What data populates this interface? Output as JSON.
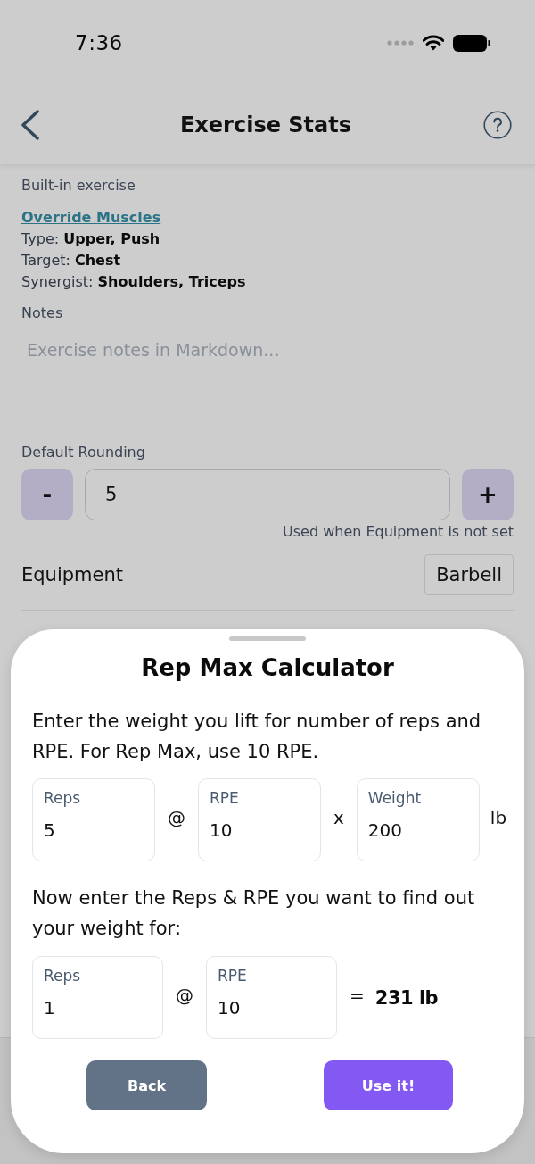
{
  "status_bar": {
    "time": "7:36"
  },
  "header": {
    "title": "Exercise Stats"
  },
  "exercise": {
    "subtitle": "Built-in exercise",
    "override_link": "Override Muscles",
    "muscles": [
      "Type: **Upper, Push**",
      "Target: **Chest**",
      "Synergist: **Shoulders, Triceps**"
    ]
  },
  "notes": {
    "label": "Notes",
    "placeholder": "Exercise notes in Markdown..."
  },
  "rounding": {
    "label": "Default Rounding",
    "decrement": "-",
    "value": "5",
    "increment": "+",
    "hint": "Used when Equipment is not set"
  },
  "equipment": {
    "label": "Equipment",
    "value": "Barbell"
  },
  "calculator": {
    "title": "Rep Max Calculator",
    "intro": "Enter the weight you lift for number of reps and RPE. For Rep Max, use 10 RPE.",
    "known_row": [
      {
        "kind": "field",
        "label": "Reps",
        "value": "5"
      },
      {
        "kind": "symbol",
        "text": "@"
      },
      {
        "kind": "field",
        "label": "RPE",
        "value": "10"
      },
      {
        "kind": "symbol",
        "text": "x"
      },
      {
        "kind": "field",
        "label": "Weight",
        "value": "200"
      },
      {
        "kind": "unit",
        "text": "lb"
      }
    ],
    "target_prompt": "Now enter the Reps & RPE you want to find out your weight for:",
    "target_row": [
      {
        "kind": "field",
        "label": "Reps",
        "value": "1"
      },
      {
        "kind": "symbol",
        "text": "@"
      },
      {
        "kind": "field",
        "label": "RPE",
        "value": "10"
      },
      {
        "kind": "symbol",
        "text": "="
      },
      {
        "kind": "result",
        "text": "231 lb"
      }
    ],
    "buttons": [
      {
        "label": "Back",
        "kind": "secondary"
      },
      {
        "label": "Use it!",
        "kind": "primary"
      }
    ]
  }
}
